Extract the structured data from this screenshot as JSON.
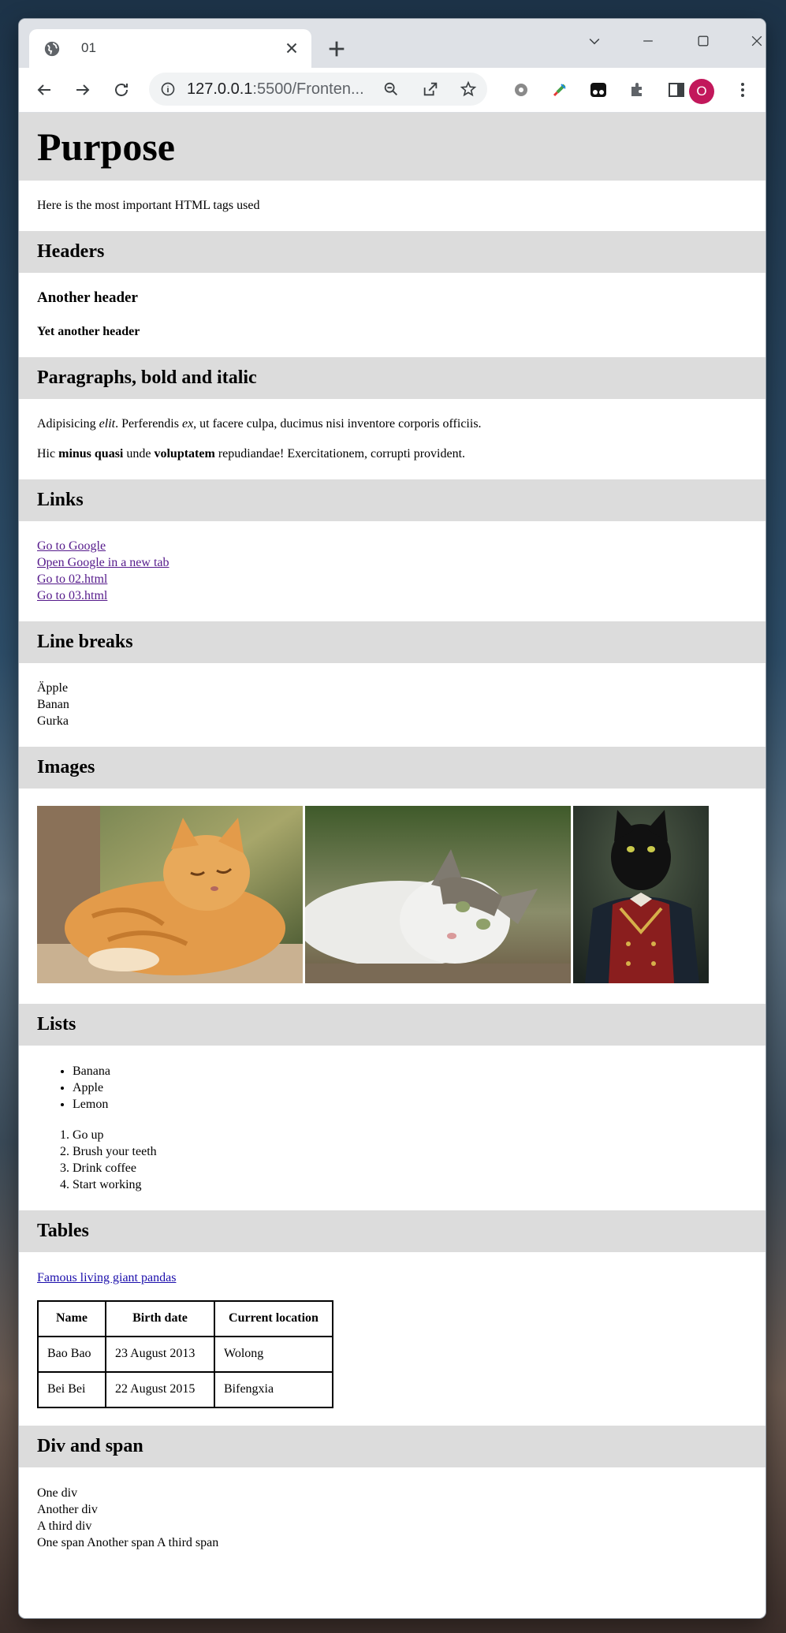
{
  "browser": {
    "tab_title": "01",
    "url_host": "127.0.0.1",
    "url_rest": ":5500/Fronten...",
    "avatar_letter": "O",
    "avatar_color": "#c2185b"
  },
  "page": {
    "h1": "Purpose",
    "intro": "Here is the most important HTML tags used",
    "headers": {
      "title": "Headers",
      "h3": "Another header",
      "h4": "Yet another header"
    },
    "paragraphs": {
      "title": "Paragraphs, bold and italic",
      "p1_a": "Adipisicing ",
      "p1_em1": "elit",
      "p1_b": ". Perferendis ",
      "p1_em2": "ex",
      "p1_c": ", ut facere culpa, ducimus nisi inventore corporis officiis.",
      "p2_a": "Hic ",
      "p2_strong1": "minus quasi",
      "p2_b": " unde ",
      "p2_strong2": "voluptatem",
      "p2_c": " repudiandae! Exercitationem, corrupti provident."
    },
    "links": {
      "title": "Links",
      "items": [
        "Go to Google",
        "Open Google in a new tab",
        "Go to 02.html",
        "Go to 03.html"
      ]
    },
    "line_breaks": {
      "title": "Line breaks",
      "lines": [
        "Äpple",
        "Banan",
        "Gurka"
      ]
    },
    "images": {
      "title": "Images",
      "items": [
        "orange-cat-sleeping",
        "tabby-white-cat-lying",
        "black-cat-portrait"
      ]
    },
    "lists": {
      "title": "Lists",
      "unordered": [
        "Banana",
        "Apple",
        "Lemon"
      ],
      "ordered": [
        "Go up",
        "Brush your teeth",
        "Drink coffee",
        "Start working"
      ]
    },
    "tables": {
      "title": "Tables",
      "link": "Famous living giant pandas",
      "headers": [
        "Name",
        "Birth date",
        "Current location"
      ],
      "rows": [
        [
          "Bao Bao",
          "23 August 2013",
          "Wolong"
        ],
        [
          "Bei Bei",
          "22 August 2015",
          "Bifengxia"
        ]
      ]
    },
    "div_span": {
      "title": "Div and span",
      "divs": [
        "One div",
        "Another div",
        "A third div"
      ],
      "spans": [
        "One span",
        "Another span",
        "A third span"
      ]
    }
  }
}
